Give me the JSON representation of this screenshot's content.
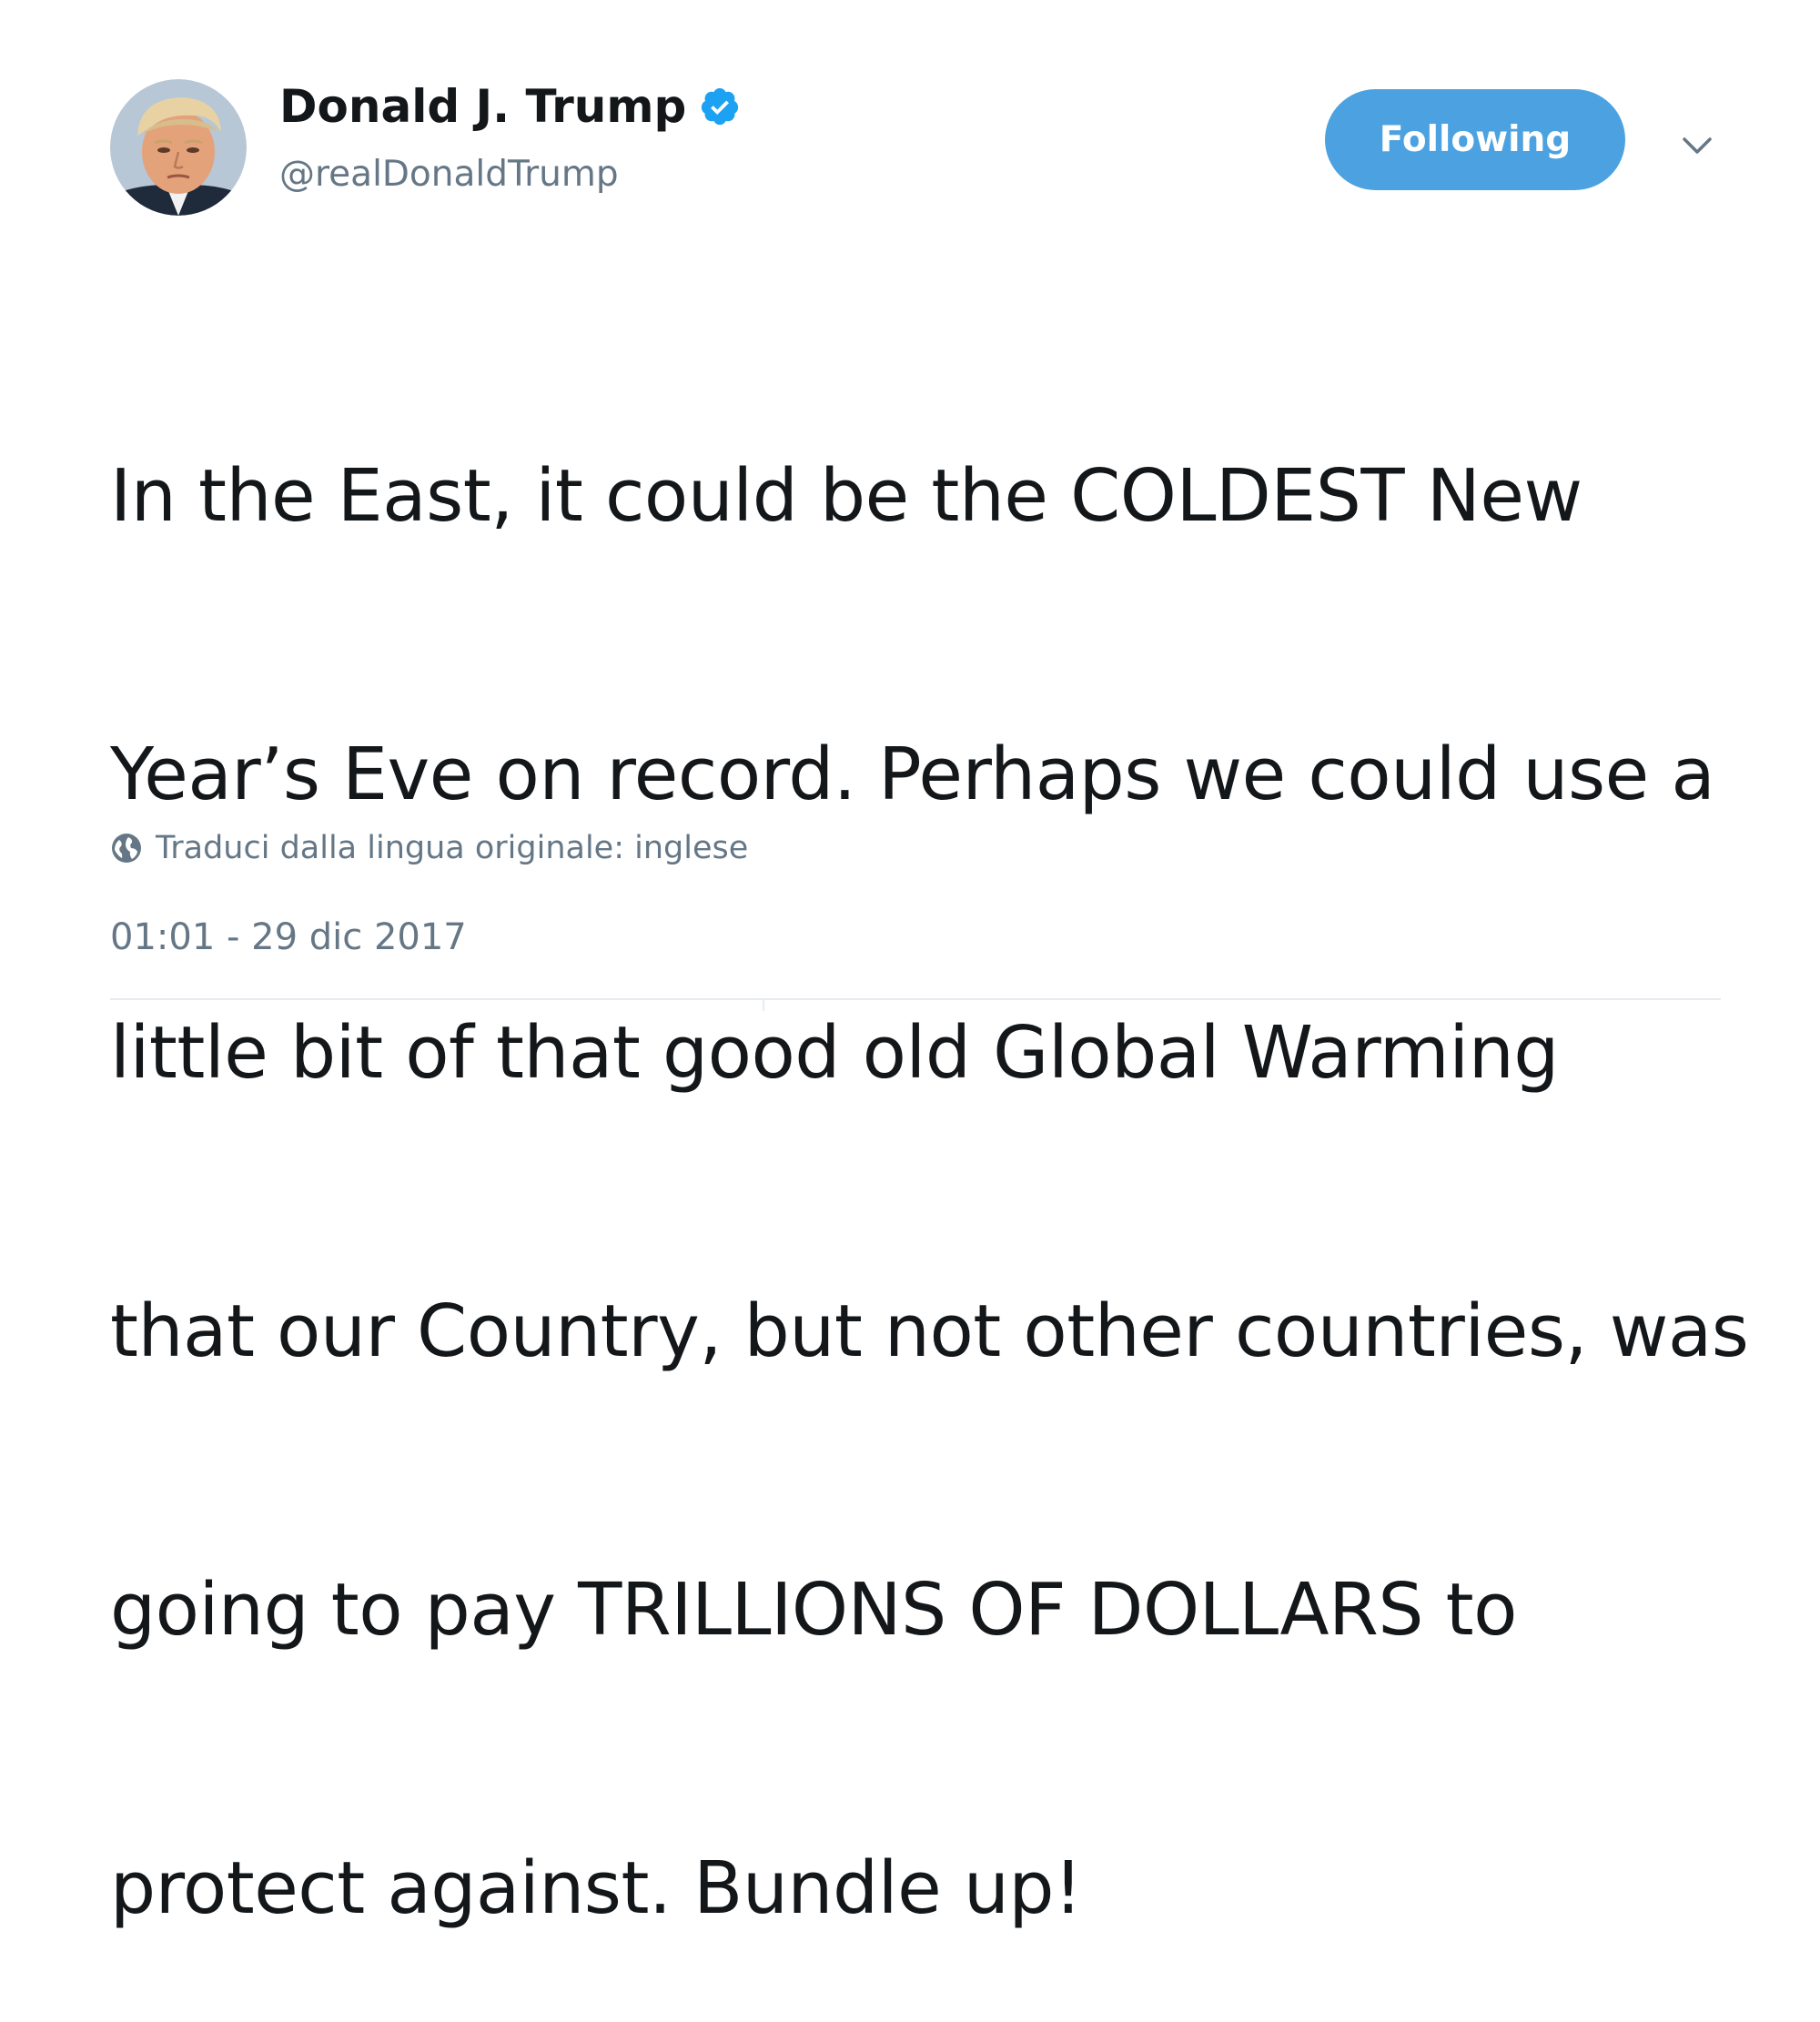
{
  "author": {
    "display_name": "Donald J. Trump",
    "handle": "@realDonaldTrump",
    "verified": true,
    "verified_icon": "verified-badge-icon",
    "avatar": "profile-photo"
  },
  "follow_button": {
    "label": "Following"
  },
  "menu": {
    "icon": "chevron-down-icon"
  },
  "tweet": {
    "text_lines": [
      "In the East, it could be the COLDEST New",
      "Year’s Eve on record. Perhaps we could use a",
      "little bit of that good old Global Warming",
      "that our Country, but not other countries, was",
      "going to pay TRILLIONS OF DOLLARS to",
      "protect against. Bundle up!"
    ],
    "translate_label": "Traduci dalla lingua originale: inglese",
    "translate_icon": "globe-icon",
    "timestamp": "01:01 - 29 dic 2017"
  },
  "colors": {
    "accent": "#4ca2e0",
    "verified_blue": "#1da1f2",
    "text_primary": "#14171a",
    "text_secondary": "#657786",
    "divider": "#e6ecf0"
  }
}
